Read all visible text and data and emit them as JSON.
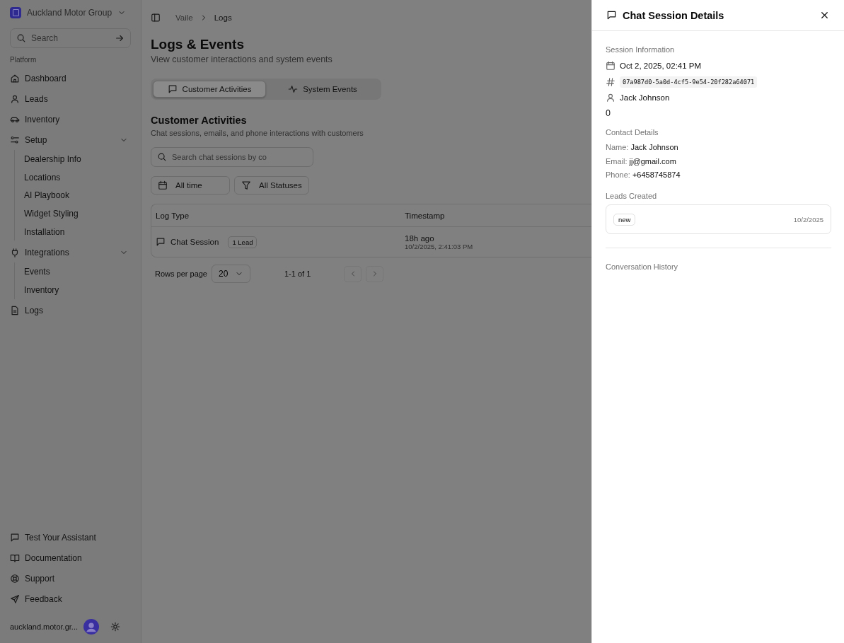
{
  "org": {
    "name": "Auckland Motor Group"
  },
  "search": {
    "placeholder": "Search"
  },
  "nav": {
    "section": "Platform",
    "items": [
      {
        "label": "Dashboard"
      },
      {
        "label": "Leads"
      },
      {
        "label": "Inventory"
      },
      {
        "label": "Setup",
        "expanded": true,
        "children": [
          {
            "label": "Dealership Info"
          },
          {
            "label": "Locations"
          },
          {
            "label": "AI Playbook"
          },
          {
            "label": "Widget Styling"
          },
          {
            "label": "Installation"
          }
        ]
      },
      {
        "label": "Integrations",
        "expanded": true,
        "children": [
          {
            "label": "Events"
          },
          {
            "label": "Inventory"
          }
        ]
      },
      {
        "label": "Logs"
      }
    ]
  },
  "footer_links": [
    {
      "label": "Test Your Assistant"
    },
    {
      "label": "Documentation"
    },
    {
      "label": "Support"
    },
    {
      "label": "Feedback"
    }
  ],
  "user": {
    "name": "auckland.motor.gr..."
  },
  "breadcrumb": [
    "Vaile",
    "Logs"
  ],
  "page": {
    "title": "Logs & Events",
    "subtitle": "View customer interactions and system events"
  },
  "tabs": [
    {
      "label": "Customer Activities",
      "selected": true
    },
    {
      "label": "System Events",
      "selected": false
    }
  ],
  "section": {
    "title": "Customer Activities",
    "subtitle": "Chat sessions, emails, and phone interactions with customers"
  },
  "filter_search": {
    "placeholder": "Search chat sessions by co"
  },
  "filters": [
    "All time",
    "All Statuses"
  ],
  "table": {
    "columns": [
      "Log Type",
      "Timestamp"
    ],
    "rows": [
      {
        "type": "Chat Session",
        "badge": "1 Lead",
        "time": "18h ago",
        "date": "10/2/2025, 2:41:03 PM"
      }
    ]
  },
  "pagination": {
    "label": "Rows per page",
    "value": "20",
    "range": "1-1 of 1"
  },
  "drawer": {
    "title": "Chat Session Details",
    "session": {
      "heading": "Session Information",
      "date": "Oct 2, 2025, 02:41 PM",
      "id": "07a987d0-5a0d-4cf5-9e54-20f282a64071",
      "customer": "Jack Johnson",
      "extra": "0"
    },
    "contact": {
      "heading": "Contact Details",
      "fields": [
        {
          "label": "Name:",
          "value": "Jack Johnson"
        },
        {
          "label": "Email:",
          "value": "jj@gmail.com"
        },
        {
          "label": "Phone:",
          "value": "+6458745874"
        }
      ]
    },
    "leads": {
      "heading": "Leads Created",
      "items": [
        {
          "status": "new",
          "date": "10/2/2025"
        }
      ]
    },
    "conversation": {
      "heading": "Conversation History"
    }
  }
}
